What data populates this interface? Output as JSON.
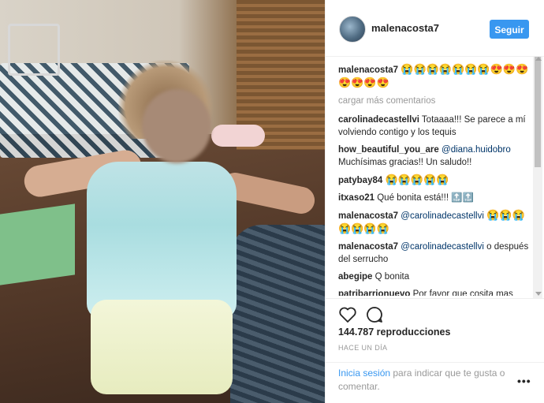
{
  "post": {
    "username": "malenacosta7",
    "follow_label": "Seguir",
    "views": "144.787 reproducciones",
    "time": "HACE UN DÍA",
    "login_link": "Inicia sesión",
    "login_rest": " para indicar que te gusta o comentar.",
    "more_label": "•••"
  },
  "caption": {
    "user": "malenacosta7",
    "text": "😭😭😭😭😭😭😭😍😍😍😍😍😍😍"
  },
  "load_more": "cargar más comentarios",
  "comments": [
    {
      "user": "carolinadecastellvi",
      "mention": "",
      "text": "Totaaaa!!! Se parece a mí volviendo contigo y los tequis"
    },
    {
      "user": "how_beautiful_you_are",
      "mention": "@diana.huidobro",
      "text": "Muchísimas gracias!! Un saludo!!"
    },
    {
      "user": "patybay84",
      "mention": "",
      "text": "😭😭😭😭😭"
    },
    {
      "user": "itxaso21",
      "mention": "",
      "text": "Qué bonita está!!! 🔝🔝"
    },
    {
      "user": "malenacosta7",
      "mention": "@carolinadecastellvi",
      "text": "😭😭😭😭😭😭😭"
    },
    {
      "user": "malenacosta7",
      "mention": "@carolinadecastellvi",
      "text": "o después del serrucho"
    },
    {
      "user": "abegipe",
      "mention": "",
      "text": "Q bonita"
    },
    {
      "user": "patribarrionuevo",
      "mention": "",
      "text": "Por favor que cosita mas linda!😍"
    }
  ],
  "colors": {
    "accent": "#3897f0",
    "text": "#262626",
    "muted": "#999999"
  },
  "icons": [
    "heart-icon",
    "comment-icon",
    "more-options-icon"
  ]
}
